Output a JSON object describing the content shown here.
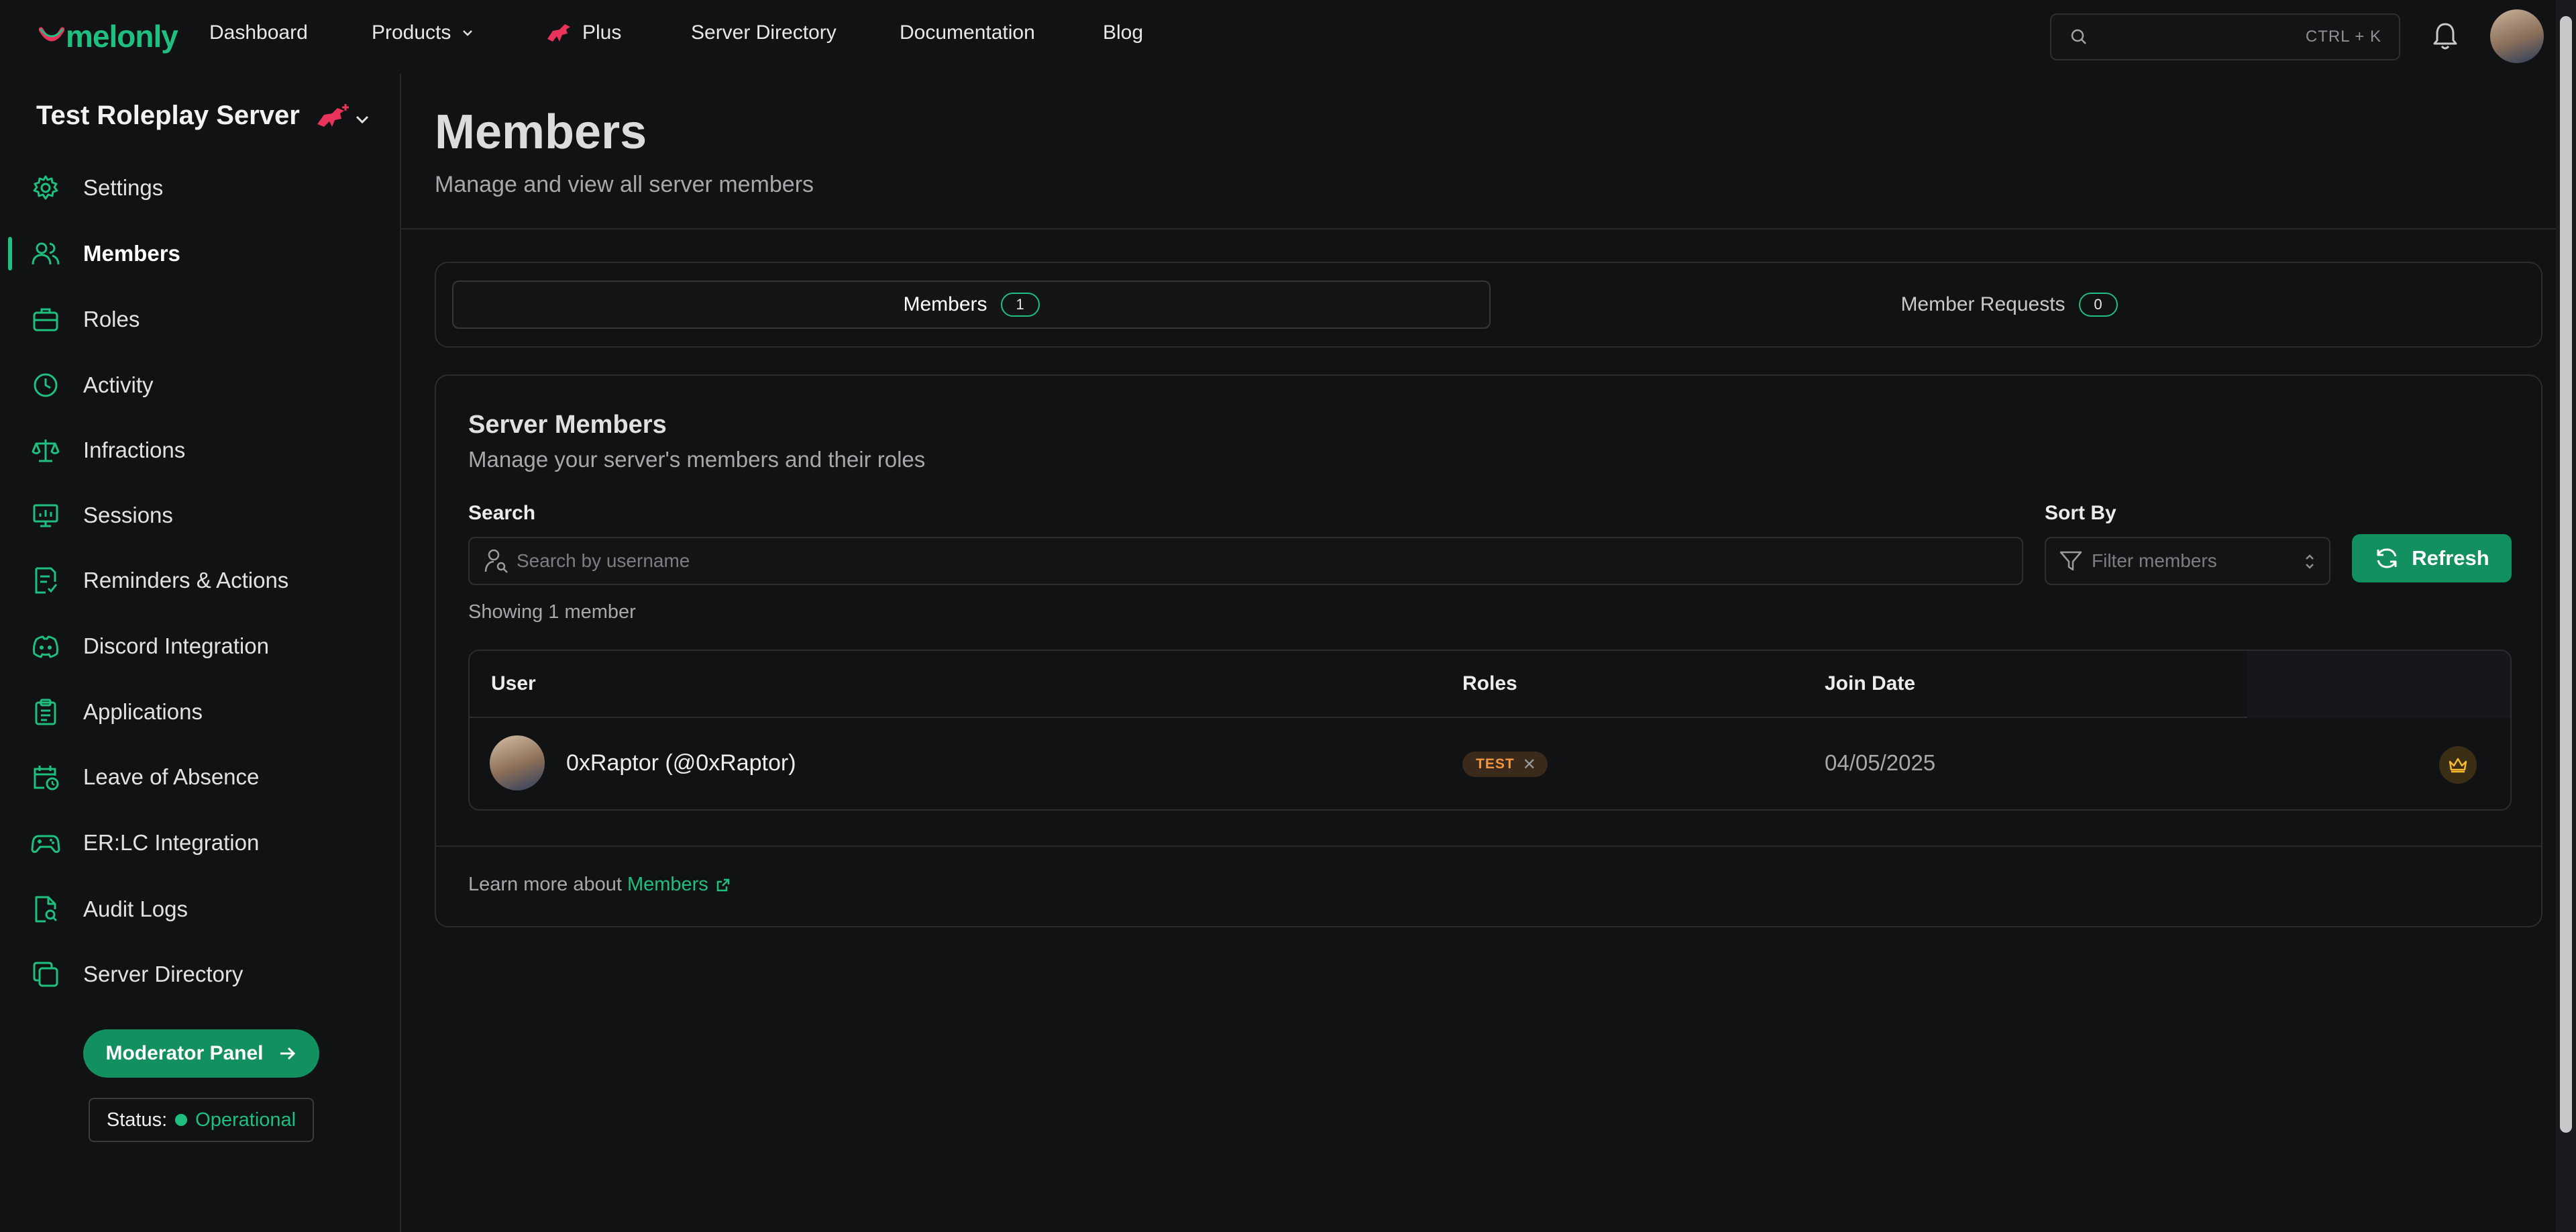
{
  "brand": {
    "name": "melonly",
    "accent": "#1fbf7f"
  },
  "nav": {
    "dashboard": "Dashboard",
    "products": "Products",
    "plus": "Plus",
    "server_directory": "Server Directory",
    "documentation": "Documentation",
    "blog": "Blog",
    "search_shortcut": "CTRL + K"
  },
  "sidebar": {
    "server_name": "Test Roleplay Server",
    "items": [
      {
        "label": "Settings",
        "icon": "gear-icon"
      },
      {
        "label": "Members",
        "icon": "users-icon",
        "active": true
      },
      {
        "label": "Roles",
        "icon": "briefcase-icon"
      },
      {
        "label": "Activity",
        "icon": "clock-icon"
      },
      {
        "label": "Infractions",
        "icon": "scale-icon"
      },
      {
        "label": "Sessions",
        "icon": "presentation-icon"
      },
      {
        "label": "Reminders & Actions",
        "icon": "checklist-icon"
      },
      {
        "label": "Discord Integration",
        "icon": "discord-icon"
      },
      {
        "label": "Applications",
        "icon": "clipboard-icon"
      },
      {
        "label": "Leave of Absence",
        "icon": "calendar-clock-icon"
      },
      {
        "label": "ER:LC Integration",
        "icon": "gamepad-icon"
      },
      {
        "label": "Audit Logs",
        "icon": "file-search-icon"
      },
      {
        "label": "Server Directory",
        "icon": "copy-icon"
      }
    ],
    "moderator_panel": "Moderator Panel",
    "status_label": "Status:",
    "status_value": "Operational"
  },
  "main": {
    "title": "Members",
    "subtitle": "Manage and view all server members",
    "tabs": [
      {
        "label": "Members",
        "count": "1"
      },
      {
        "label": "Member Requests",
        "count": "0"
      }
    ],
    "card": {
      "title": "Server Members",
      "subtitle": "Manage your server's members and their roles",
      "search_label": "Search",
      "search_placeholder": "Search by username",
      "sort_label": "Sort By",
      "sort_placeholder": "Filter members",
      "refresh": "Refresh",
      "showing": "Showing 1 member",
      "columns": [
        "User",
        "Roles",
        "Join Date"
      ],
      "rows": [
        {
          "user": "0xRaptor (@0xRaptor)",
          "role": "TEST",
          "join_date": "04/05/2025"
        }
      ],
      "learn_prefix": "Learn more about",
      "learn_link": "Members"
    }
  }
}
